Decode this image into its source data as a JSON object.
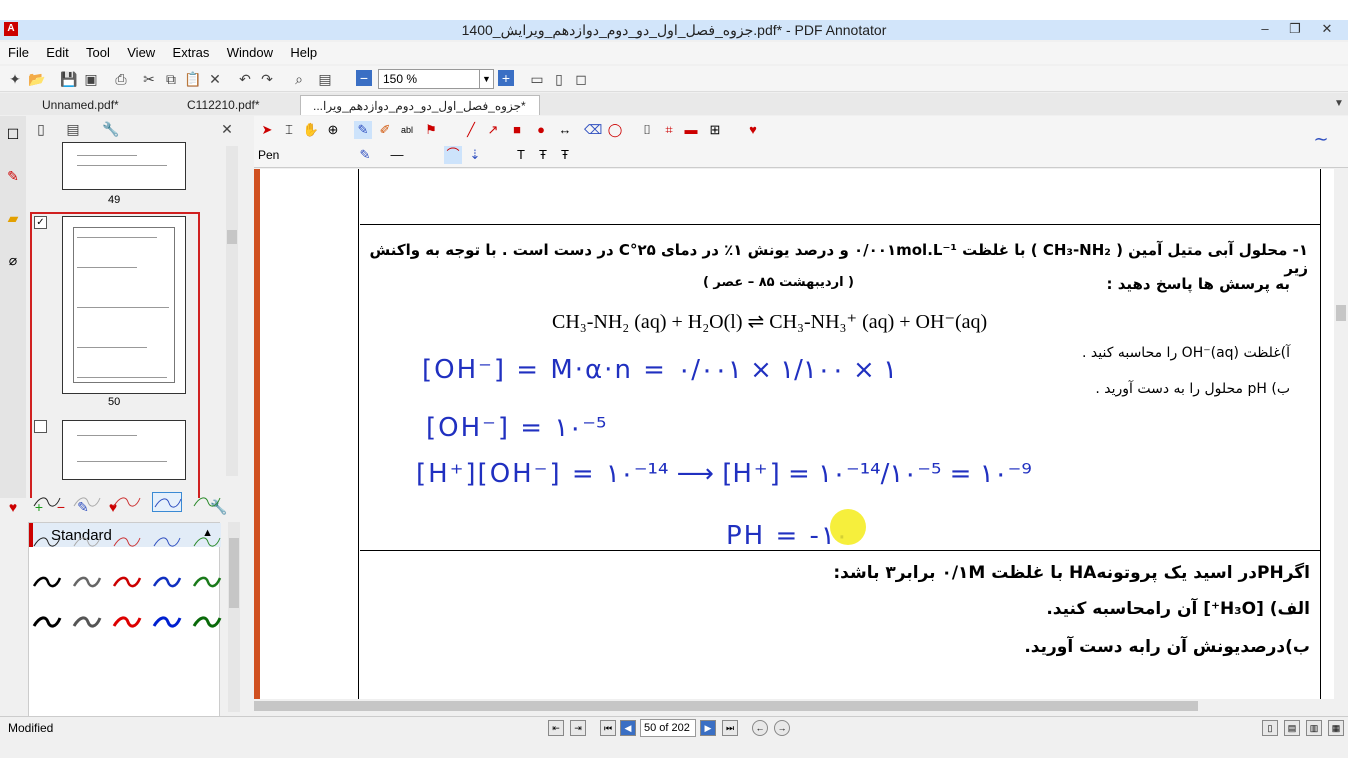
{
  "window": {
    "title": "جزوه_فصل_اول_دو_دوم_دوازدهم_ویرایش_1400.pdf* - PDF Annotator",
    "app_icon": "pdf-annotator-icon"
  },
  "menu": [
    "File",
    "Edit",
    "Tool",
    "View",
    "Extras",
    "Window",
    "Help"
  ],
  "toolbar": {
    "zoom": "150 %"
  },
  "tabs": [
    "Unnamed.pdf*",
    "C112210.pdf*",
    "...جزوه_فصل_اول_دو_دوم_دوازدهم_ویرا*"
  ],
  "sidebar": {
    "thumbs": [
      {
        "label": "49"
      },
      {
        "label": "50"
      }
    ],
    "pen_set": "Standard"
  },
  "annot_toolbar": {
    "current_tool": "Pen"
  },
  "document": {
    "q1_line1": "۱- محلول آبی متیل آمین ( CH₃-NH₂ ) با غلظت ۰/۰۰۱mol.L⁻¹ و درصد یونش ۱٪ در دمای ۲۵°C در دست است . با توجه به واکنش زیر",
    "q1_line2": "به پرسش ها پاسخ دهید :",
    "q1_source": "( اردیبهشت ۸۵ – عصر )",
    "reaction": "CH₃-NH₂ (aq) + H₂O(l)  ⇌  CH₃-NH₃⁺ (aq) + OH⁻(aq)",
    "q1_a": "آ)غلظت OH⁻(aq) را محاسبه کنید .",
    "q1_b": "ب) pH محلول را به دست آورید .",
    "hw1": "[OH⁻] = M·α·n = ۰/۰۰۱ × ۱/۱۰۰ × ۱",
    "hw2": "[OH⁻] = ۱۰⁻⁵",
    "hw3": "[H⁺][OH⁻] = ۱۰⁻¹⁴ ⟶ [H⁺] = ۱۰⁻¹⁴/۱۰⁻⁵ = ۱۰⁻⁹",
    "hw4": "PH = -۱۰",
    "q2_line1": "اگرPHدر اسید یک پروتونهHA با غلظت ۰/۱M برابر۳ باشد:",
    "q2_a": "الف) [H₃O⁺] آن رامحاسبه کنید.",
    "q2_b": "ب)درصدیونش آن رابه دست آورید."
  },
  "status": {
    "text": "Modified",
    "page": "50 of 202"
  }
}
